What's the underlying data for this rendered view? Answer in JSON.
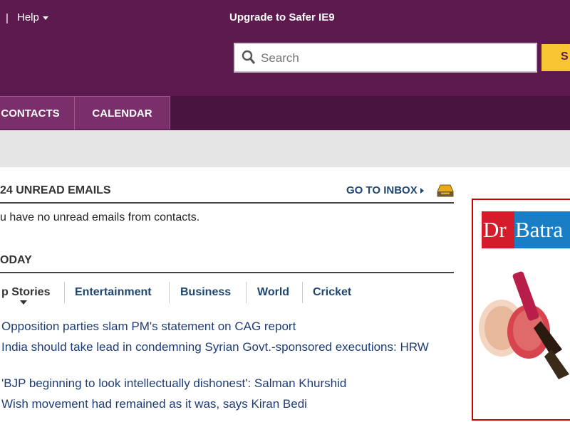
{
  "header": {
    "separator": "|",
    "help_label": "Help",
    "upgrade_label": "Upgrade to Safer IE9"
  },
  "search": {
    "placeholder": "Search",
    "button_label": "S"
  },
  "nav": {
    "tabs": [
      {
        "label": "CONTACTS"
      },
      {
        "label": "CALENDAR"
      }
    ]
  },
  "mail": {
    "unread_heading": "24 UNREAD EMAILS",
    "go_to_inbox": "GO TO INBOX",
    "no_unread_text": "u have no unread emails from contacts."
  },
  "news": {
    "heading": "ODAY",
    "tabs": [
      {
        "label": "p Stories",
        "active": true
      },
      {
        "label": "Entertainment"
      },
      {
        "label": "Business"
      },
      {
        "label": "World"
      },
      {
        "label": "Cricket"
      }
    ],
    "stories": [
      "Opposition parties slam PM's statement on CAG report",
      "India should take lead in condemning Syrian Govt.-sponsored executions: HRW",
      "'BJP beginning to look intellectually dishonest': Salman Khurshid",
      "Wish movement had remained as it was, says Kiran Bedi"
    ]
  },
  "ad": {
    "brand_part1": "Dr",
    "brand_part2": "Batra"
  },
  "colors": {
    "header_bg": "#5c1a4e",
    "nav_bg": "#4a1440",
    "tab_bg": "#7a2f6b",
    "search_button": "#f8c630",
    "link": "#1e3c78"
  }
}
